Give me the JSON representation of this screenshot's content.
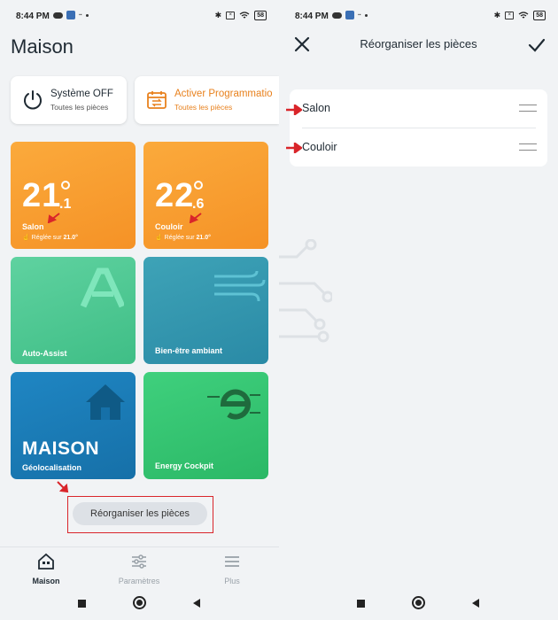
{
  "status": {
    "time": "8:44 PM",
    "battery": "58"
  },
  "home": {
    "title": "Maison",
    "modes": [
      {
        "title": "Système OFF",
        "subtitle": "Toutes les pièces"
      },
      {
        "title": "Activer Programmatio",
        "subtitle": "Toutes les pièces"
      }
    ],
    "rooms": [
      {
        "temp_int": "21",
        "temp_dec": ".1",
        "name": "Salon",
        "setpoint_prefix": "Réglée sur",
        "setpoint": "21.0°"
      },
      {
        "temp_int": "22",
        "temp_dec": ".6",
        "name": "Couloir",
        "setpoint_prefix": "Réglée sur",
        "setpoint": "21.0°"
      }
    ],
    "features": [
      {
        "name": "Auto-Assist"
      },
      {
        "name": "Bien-être ambiant"
      },
      {
        "big": "MAISON",
        "name": "Géolocalisation"
      },
      {
        "name": "Energy Cockpit"
      }
    ],
    "reorganize_button": "Réorganiser les pièces",
    "nav": [
      {
        "label": "Maison",
        "icon": "home-icon"
      },
      {
        "label": "Paramètres",
        "icon": "sliders-icon"
      },
      {
        "label": "Plus",
        "icon": "menu-icon"
      }
    ]
  },
  "reorder": {
    "title": "Réorganiser les pièces",
    "rooms": [
      "Salon",
      "Couloir"
    ]
  },
  "colors": {
    "accent": "#e8811d",
    "highlight": "#d9252a"
  }
}
